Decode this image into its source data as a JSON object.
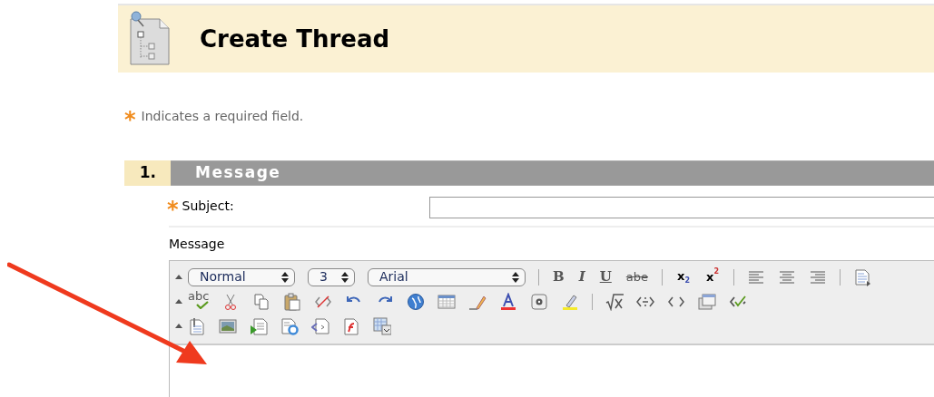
{
  "header": {
    "title": "Create Thread"
  },
  "required_note": {
    "mark": "*",
    "text": "Indicates a required field."
  },
  "section": {
    "number": "1.",
    "title": "Message"
  },
  "subject": {
    "mark": "*",
    "label": "Subject:"
  },
  "message": {
    "label": "Message"
  },
  "toolbar": {
    "rows": [
      [
        {
          "kind": "collapse"
        },
        {
          "kind": "select",
          "value": "Normal"
        },
        {
          "kind": "select",
          "value": "3"
        },
        {
          "kind": "select",
          "value": "Arial"
        },
        {
          "kind": "separator"
        },
        {
          "kind": "glyph",
          "label": "B"
        },
        {
          "kind": "glyph",
          "label": "I"
        },
        {
          "kind": "glyph",
          "label": "U"
        },
        {
          "kind": "glyph",
          "label": "abe"
        },
        {
          "kind": "separator"
        },
        {
          "kind": "script",
          "label": "x",
          "index": "2"
        },
        {
          "kind": "script",
          "label": "x",
          "index": "2"
        },
        {
          "kind": "separator"
        },
        {
          "kind": "icon"
        },
        {
          "kind": "icon"
        },
        {
          "kind": "icon"
        },
        {
          "kind": "separator"
        },
        {
          "kind": "icon"
        }
      ],
      [
        {
          "kind": "collapse"
        },
        {
          "kind": "spell",
          "label": "abc"
        },
        {
          "kind": "icon"
        },
        {
          "kind": "icon"
        },
        {
          "kind": "icon"
        },
        {
          "kind": "icon"
        },
        {
          "kind": "icon"
        },
        {
          "kind": "icon"
        },
        {
          "kind": "icon"
        },
        {
          "kind": "icon"
        },
        {
          "kind": "icon"
        },
        {
          "kind": "icon"
        },
        {
          "kind": "icon"
        },
        {
          "kind": "icon"
        },
        {
          "kind": "separator"
        },
        {
          "kind": "icon"
        },
        {
          "kind": "icon"
        },
        {
          "kind": "icon"
        },
        {
          "kind": "icon"
        },
        {
          "kind": "icon"
        }
      ],
      [
        {
          "kind": "collapse"
        },
        {
          "kind": "icon"
        },
        {
          "kind": "icon"
        },
        {
          "kind": "icon"
        },
        {
          "kind": "icon"
        },
        {
          "kind": "icon"
        },
        {
          "kind": "icon"
        },
        {
          "kind": "icon"
        }
      ]
    ]
  },
  "annotation": {
    "kind": "arrow"
  }
}
